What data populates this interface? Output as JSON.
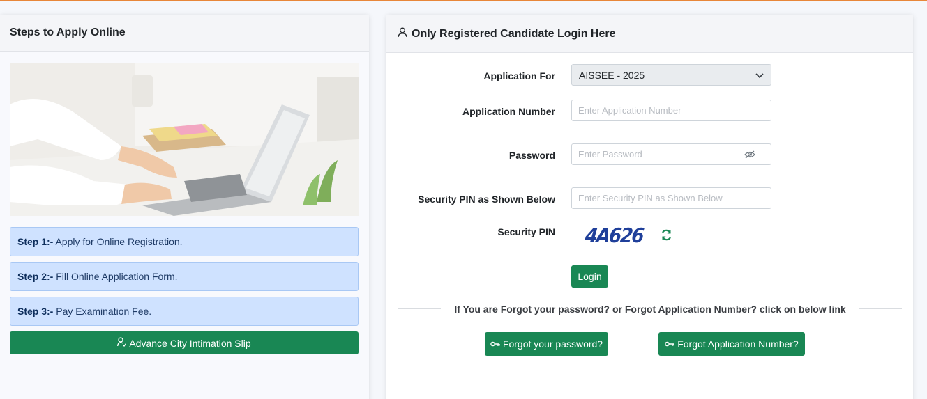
{
  "steps_panel": {
    "title": "Steps to Apply Online",
    "steps": [
      {
        "prefix": "Step 1:-",
        "text": "Apply for Online Registration."
      },
      {
        "prefix": "Step 2:-",
        "text": "Fill Online Application Form."
      },
      {
        "prefix": "Step 3:-",
        "text": "Pay Examination Fee."
      }
    ],
    "slip_button": "Advance City Intimation Slip"
  },
  "login_panel": {
    "title": "Only Registered Candidate Login Here",
    "application_for": {
      "label": "Application For",
      "value": "AISSEE - 2025"
    },
    "application_number": {
      "label": "Application Number",
      "placeholder": "Enter Application Number"
    },
    "password": {
      "label": "Password",
      "placeholder": "Enter Password"
    },
    "security_pin_input": {
      "label": "Security PIN as Shown Below",
      "placeholder": "Enter Security PIN as Shown Below"
    },
    "security_pin": {
      "label": "Security PIN",
      "captcha": "4A626"
    },
    "login_button": "Login",
    "forgot_text": "If You are Forgot your password? or Forgot Application Number? click on below link",
    "forgot_password_button": "Forgot your password?",
    "forgot_app_number_button": "Forgot Application Number?"
  },
  "colors": {
    "accent_top_line": "#e8873a",
    "button_green": "#198754",
    "step_background": "#cfe2ff",
    "captcha_text": "#1f3f9a"
  },
  "icons": [
    "user-icon",
    "person-badge-icon",
    "chevron-down-icon",
    "eye-slash-icon",
    "refresh-icon",
    "key-icon"
  ]
}
